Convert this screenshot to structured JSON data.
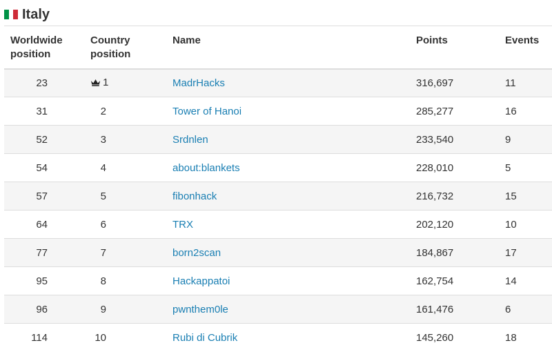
{
  "header": {
    "title": "Italy",
    "flag_colors": [
      "#009246",
      "#ffffff",
      "#ce2b37"
    ]
  },
  "table": {
    "columns": [
      "Worldwide position",
      "Country position",
      "Name",
      "Points",
      "Events"
    ],
    "column_lines": [
      [
        "Worldwide",
        "position"
      ],
      [
        "Country",
        "position"
      ],
      [
        "Name"
      ],
      [
        "Points"
      ],
      [
        "Events"
      ]
    ],
    "rows": [
      {
        "worldwide": "23",
        "country": "1",
        "name": "MadrHacks",
        "points": "316,697",
        "events": "11",
        "icon": "crown-icon"
      },
      {
        "worldwide": "31",
        "country": "2",
        "name": "Tower of Hanoi",
        "points": "285,277",
        "events": "16"
      },
      {
        "worldwide": "52",
        "country": "3",
        "name": "Srdnlen",
        "points": "233,540",
        "events": "9"
      },
      {
        "worldwide": "54",
        "country": "4",
        "name": "about:blankets",
        "points": "228,010",
        "events": "5"
      },
      {
        "worldwide": "57",
        "country": "5",
        "name": "fibonhack",
        "points": "216,732",
        "events": "15"
      },
      {
        "worldwide": "64",
        "country": "6",
        "name": "TRX",
        "points": "202,120",
        "events": "10"
      },
      {
        "worldwide": "77",
        "country": "7",
        "name": "born2scan",
        "points": "184,867",
        "events": "17"
      },
      {
        "worldwide": "95",
        "country": "8",
        "name": "Hackappatoi",
        "points": "162,754",
        "events": "14"
      },
      {
        "worldwide": "96",
        "country": "9",
        "name": "pwnthem0le",
        "points": "161,476",
        "events": "6"
      },
      {
        "worldwide": "114",
        "country": "10",
        "name": "Rubi di Cubrik",
        "points": "145,260",
        "events": "18"
      }
    ]
  },
  "colors": {
    "link": "#1a7fb3",
    "stripe": "#f5f5f5",
    "border": "#dddddd"
  }
}
